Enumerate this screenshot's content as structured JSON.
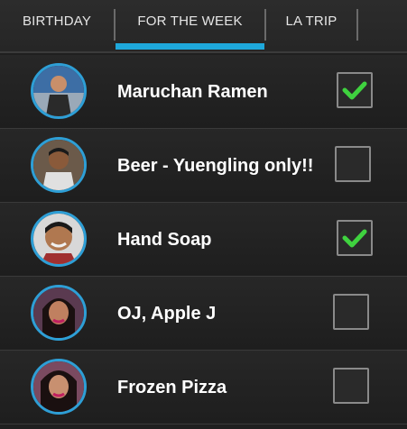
{
  "tabs": [
    {
      "label": "BIRTHDAY",
      "selected": false
    },
    {
      "label": "FOR THE WEEK",
      "selected": true
    },
    {
      "label": "LA TRIP",
      "selected": false
    }
  ],
  "colors": {
    "accent": "#1ea8db",
    "check": "#3fd23f",
    "avatar_ring": "#2e9fd6"
  },
  "items": [
    {
      "label": "Maruchan Ramen",
      "checked": true,
      "avatar_icon": "person-avatar-icon"
    },
    {
      "label": "Beer - Yuengling only!!",
      "checked": false,
      "avatar_icon": "person-avatar-icon"
    },
    {
      "label": "Hand Soap",
      "checked": true,
      "avatar_icon": "person-avatar-icon"
    },
    {
      "label": "OJ, Apple J",
      "checked": false,
      "avatar_icon": "person-avatar-icon"
    },
    {
      "label": "Frozen Pizza",
      "checked": false,
      "avatar_icon": "person-avatar-icon"
    }
  ]
}
